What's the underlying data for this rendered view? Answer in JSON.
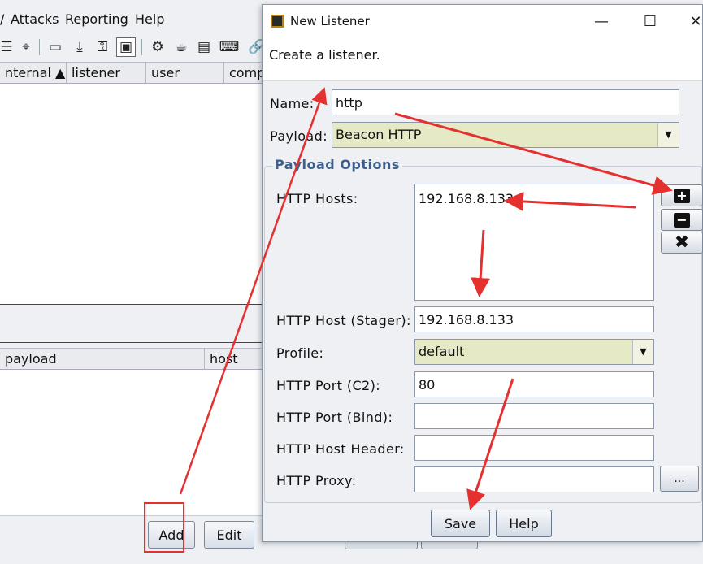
{
  "main_window": {
    "menu": [
      "Attacks",
      "Reporting",
      "Help"
    ],
    "menu_partial": "/",
    "toolbar_icons": [
      "list-icon",
      "crosshair-icon",
      "card-icon",
      "download-icon",
      "key-icon",
      "image-icon",
      "gear-icon",
      "coffee-icon",
      "document-icon",
      "terminal-icon",
      "link-icon"
    ],
    "top_table": {
      "columns": [
        "nternal ▲",
        "listener",
        "user",
        "comp"
      ]
    },
    "bottom_table": {
      "columns": [
        "payload",
        "host"
      ]
    },
    "buttons": {
      "add": "Add",
      "edit": "Edit"
    }
  },
  "dialog": {
    "title": "New Listener",
    "header": "Create a listener.",
    "name_label": "Name:",
    "name_value": "http",
    "payload_label": "Payload:",
    "payload_value": "Beacon HTTP",
    "payload_options_title": "Payload Options",
    "http_hosts_label": "HTTP Hosts:",
    "http_hosts": [
      "192.168.8.133"
    ],
    "stager_label": "HTTP Host (Stager):",
    "stager_value": "192.168.8.133",
    "profile_label": "Profile:",
    "profile_value": "default",
    "port_c2_label": "HTTP Port (C2):",
    "port_c2_value": "80",
    "port_bind_label": "HTTP Port (Bind):",
    "port_bind_value": "",
    "host_header_label": "HTTP Host Header:",
    "host_header_value": "",
    "proxy_label": "HTTP Proxy:",
    "proxy_value": "",
    "proxy_button": "...",
    "save_button": "Save",
    "help_button": "Help",
    "window_controls": {
      "minimize": "—",
      "maximize": "☐",
      "close": "✕"
    }
  },
  "annotation_color": "#e53030"
}
